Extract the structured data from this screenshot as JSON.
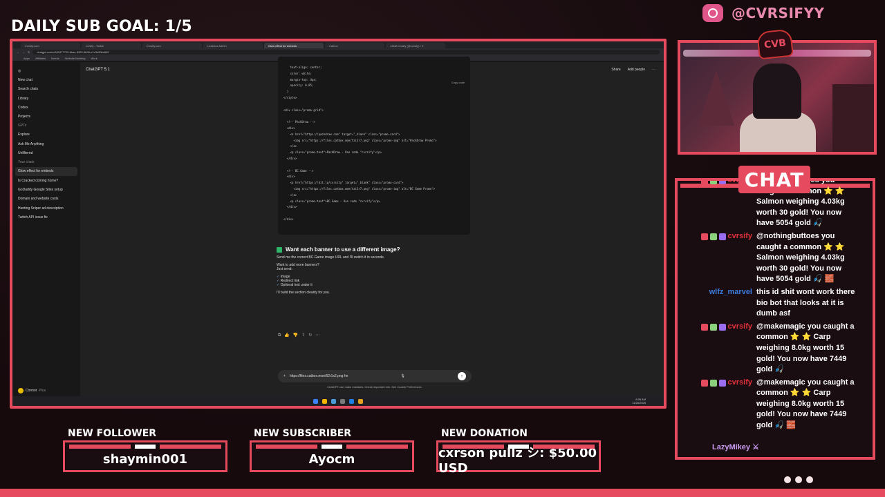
{
  "overlay": {
    "goal_text": "DAILY SUB GOAL: 1/5",
    "handle": "@CVRSIFYY",
    "logo_text": "CVB",
    "chat_title": "CHAT",
    "follower_label": "NEW FOLLOWER",
    "follower_name": "shaymin001",
    "subscriber_label": "NEW SUBSCRIBER",
    "subscriber_name": "Ayocm",
    "donation_label": "NEW DONATION",
    "donation_text": "cxrson pullz シ: $50.00 USD",
    "accent": "#e64a5f"
  },
  "browser": {
    "tabs": [
      "Cvrsify.com",
      "cvrsify - Twitch",
      "Cvrsify.com",
      "Leaktrox Admin",
      "Glow effect for embeds",
      "Catbox",
      "JJAM Cvrsify (@cvrsify) / X"
    ],
    "url": "chatgpt.com/c/692477729-6bac-8325-9b98-e1c3e50bc845",
    "bookmarks": [
      "Apps",
      "Affiliates",
      "Needs",
      "Website Building",
      "Work"
    ]
  },
  "gpt": {
    "model": "ChatGPT 5.1",
    "share": "Share",
    "add_people": "Add people",
    "sidebar": [
      "New chat",
      "Search chats",
      "Library",
      "Codex",
      "Projects"
    ],
    "gpts_label": "GPTs",
    "gpts": [
      "Explore",
      "Ask Me Anything",
      "Unfiltered"
    ],
    "chats_label": "Your chats",
    "chats": [
      "Glow effect for embeds",
      "Is Cracked coming home?",
      "GoDaddy Google Sites setup",
      "Domain and website costs",
      "Hunting Sniper ad description",
      "Twitch API issue fix"
    ],
    "user": "Connor",
    "user_plan": "Plus",
    "copy_code": "Copy code",
    "code": "    text-align: center;\n    color: white;\n    margin-top: 4px;\n    opacity: 0.85;\n  }\n</style>\n\n<div class=\"promo-grid\">\n\n  <!-- PackDraw -->\n  <div>\n    <a href=\"https://packdraw.com\" target=\"_blank\" class=\"promo-card\">\n      <img src=\"https://files.catbox.moe/tzi3r7.png\" class=\"promo-img\" alt=\"PackDraw Promo\">\n    </a>\n    <p class=\"promo-text\">PackDraw - Use code \"cvrsify\"</p>\n  </div>\n\n  <!-- BC.Game -->\n  <div>\n    <a href=\"https://bit.ly/cvrsity\" target=\"_blank\" class=\"promo-card\">\n      <img src=\"https://files.catbox.moe/tzi3r7.png\" class=\"promo-img\" alt=\"BC Game Promo\">\n    </a>\n    <p class=\"promo-text\">BC.Game - Use code \"cvrsify\"</p>\n  </div>\n\n</div>",
    "heading": "Want each banner to use a different image?",
    "p1": "Send me the correct BC.Game image URL and I'll switch it in seconds.",
    "p2": "Want to add more banners?",
    "p3": "Just send:",
    "checks": [
      "Image",
      "Redirect link",
      "Optional text under it"
    ],
    "p4": "I'll build the section cleanly for you.",
    "input_value": "https://files.catbox.moe/62r1x2.png he",
    "disclaimer": "ChatGPT can make mistakes. Check important info. See Cookie Preferences.",
    "time": "8:35 AM",
    "date": "11/26/2025"
  },
  "chat": [
    {
      "user": "cvrsify",
      "color": "#e0303a",
      "text": "@nothingbuttoes you caught a common ⭐ ⭐ Salmon weighing 4.03kg worth 30 gold! You now have 5054 gold 🎣"
    },
    {
      "user": "cvrsify",
      "color": "#e0303a",
      "text": "@nothingbuttoes you caught a common ⭐ ⭐ Salmon weighing 4.03kg worth 30 gold! You now have 5054 gold 🎣 🧱"
    },
    {
      "user": "wlfz_marvel",
      "color": "#3b7de0",
      "text": "this id shit wont work there bio bot that looks at it is dumb asf"
    },
    {
      "user": "cvrsify",
      "color": "#e0303a",
      "text": "@makemagic you caught a common ⭐ ⭐ Carp weighing 8.0kg worth 15 gold! You now have 7449 gold 🎣"
    },
    {
      "user": "cvrsify",
      "color": "#e0303a",
      "text": "@makemagic you caught a common ⭐ ⭐ Carp weighing 8.0kg worth 15 gold! You now have 7449 gold 🎣 🧱"
    }
  ],
  "last_user": "LazyMikey"
}
